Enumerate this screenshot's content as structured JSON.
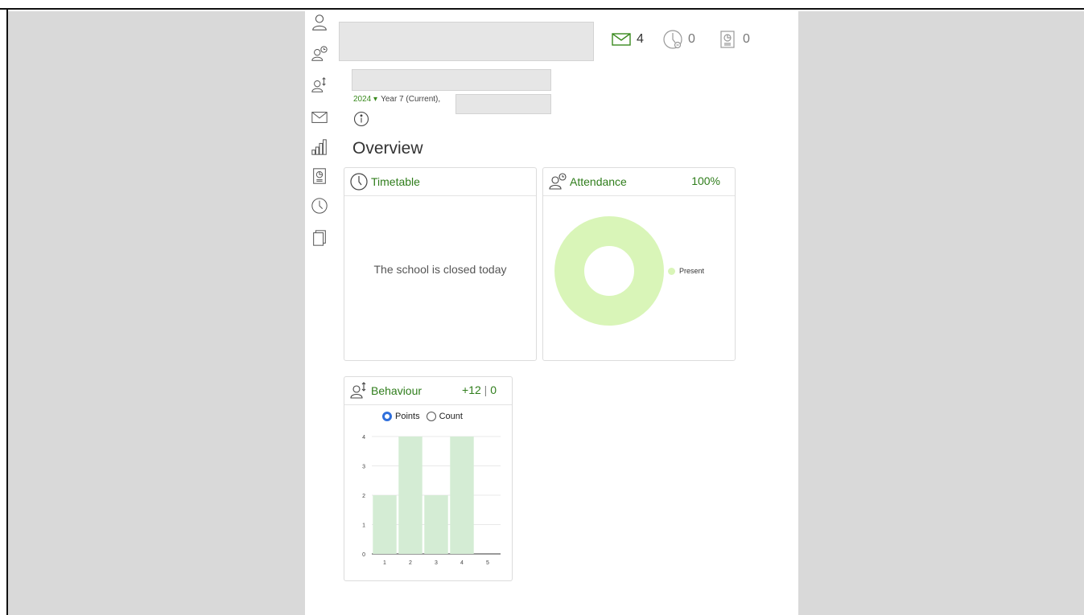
{
  "counters": {
    "messages": "4",
    "timetable": "0",
    "reports": "0"
  },
  "header": {
    "year": "2024",
    "year_info": "Year 7 (Current),"
  },
  "page": {
    "title": "Overview"
  },
  "timetable_card": {
    "title": "Timetable",
    "message": "The school is closed today"
  },
  "attendance_card": {
    "title": "Attendance",
    "value": "100%",
    "legend": "Present",
    "color": "#d9f5b8"
  },
  "behaviour_card": {
    "title": "Behaviour",
    "positive": "+12",
    "separator": "|",
    "negative": "0",
    "options": [
      "Points",
      "Count"
    ],
    "selected": "Points"
  },
  "chart_data": {
    "type": "bar",
    "categories": [
      "1",
      "2",
      "3",
      "4",
      "5"
    ],
    "values": [
      2,
      4,
      2,
      4,
      0
    ],
    "ylim": [
      0,
      4
    ],
    "yticks": [
      "0",
      "1",
      "2",
      "3",
      "4"
    ],
    "color": "#d4ecd4",
    "grid": true
  },
  "colors": {
    "accent": "#2f7d1b",
    "panel_gray": "#d9d9d9"
  }
}
